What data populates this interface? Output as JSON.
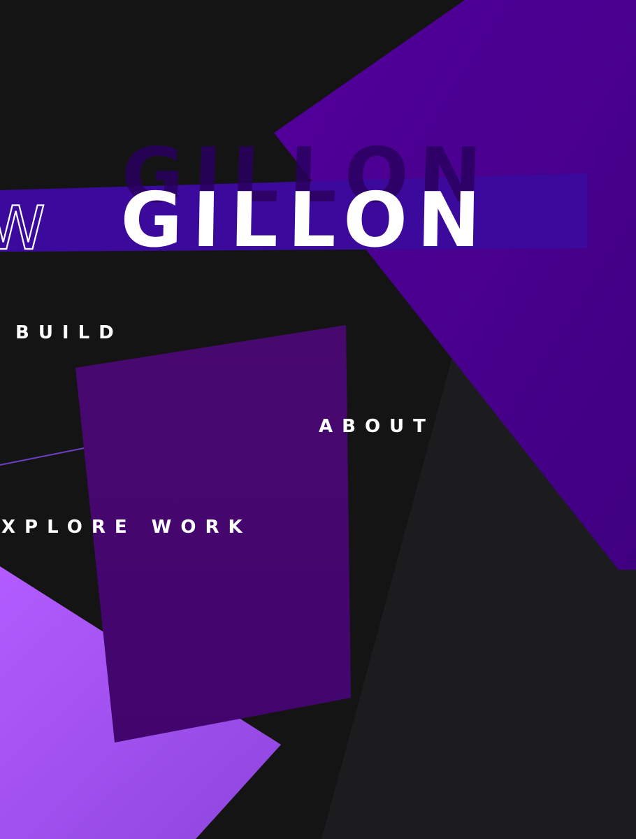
{
  "logo": {
    "first_fragment": "W",
    "last_name": "GILLON"
  },
  "nav": {
    "build": "BUILD",
    "about": "ABOUT",
    "explore_work": "XPLORE WORK"
  },
  "colors": {
    "background": "#141414",
    "dark_panel": "#1c1b1e",
    "violet_shard": "#4a0090",
    "deep_purple_card": "#44066f",
    "light_purple_shard": "#a655f0",
    "band": "#3b0a9c",
    "text": "#ffffff"
  }
}
